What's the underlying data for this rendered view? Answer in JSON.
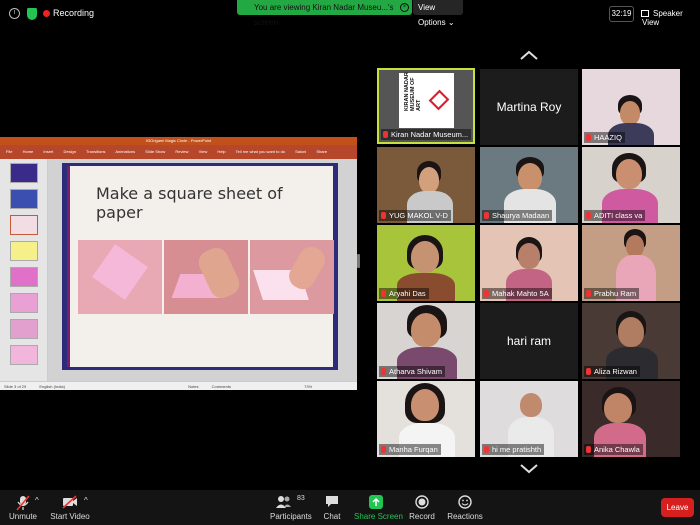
{
  "topbar": {
    "recording": "Recording",
    "viewing_text": "You are viewing Kiran Nadar Museu...'s screen",
    "view_options": "View Options",
    "timer": "32:19",
    "speaker_view": "Speaker View"
  },
  "share": {
    "window_title": "03Origami Magic Circle - PowerPoint",
    "user": "Saloni",
    "ribbon_tabs": [
      "File",
      "Home",
      "Insert",
      "Design",
      "Transitions",
      "Animations",
      "Slide Show",
      "Review",
      "View",
      "Help",
      "Tell me what you want to do"
    ],
    "share_btn": "Share",
    "slide_title": "Make a square sheet of paper",
    "status_slide": "Slide 3 of 29",
    "status_lang": "English (India)",
    "status_notes": "Notes",
    "status_comments": "Comments",
    "zoom": "73%"
  },
  "participants": [
    {
      "name": "Kiran Nadar Museum...",
      "kind": "logo",
      "active": true
    },
    {
      "name": "Martina Roy",
      "kind": "text"
    },
    {
      "name": "HAAZIQ",
      "kind": "video"
    },
    {
      "name": "YUG MAKOL V-D",
      "kind": "video"
    },
    {
      "name": "Shaurya Madaan",
      "kind": "video"
    },
    {
      "name": "ADITI class va",
      "kind": "video"
    },
    {
      "name": "Aryahi Das",
      "kind": "video"
    },
    {
      "name": "Mahak Mahto 5A",
      "kind": "video"
    },
    {
      "name": "Prabhu Ram",
      "kind": "video"
    },
    {
      "name": "Atharva Shivam",
      "kind": "video"
    },
    {
      "name": "hari ram",
      "kind": "text"
    },
    {
      "name": "Aliza Rizwan",
      "kind": "video"
    },
    {
      "name": "Manha Furqan",
      "kind": "video"
    },
    {
      "name": "hi me pratishth",
      "kind": "video"
    },
    {
      "name": "Anika Chawla",
      "kind": "video"
    }
  ],
  "logo_text": "KIRAN NADAR MUSEUM OF ART",
  "bottombar": {
    "unmute": "Unmute",
    "start_video": "Start Video",
    "participants": "Participants",
    "participant_count": "83",
    "chat": "Chat",
    "share_screen": "Share Screen",
    "record": "Record",
    "reactions": "Reactions",
    "leave": "Leave"
  },
  "colors": {
    "recording": "#e22222",
    "share_green": "#23c552",
    "active_speaker": "#c8e03a",
    "leave": "#d62020",
    "ppt_ribbon": "#b7472a"
  }
}
